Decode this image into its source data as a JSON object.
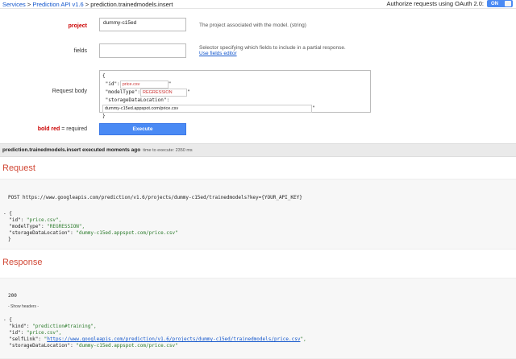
{
  "breadcrumb": {
    "services": "Services",
    "sep1": " > ",
    "api": "Prediction API v1.6",
    "sep2": " > ",
    "method": "prediction.trainedmodels.insert"
  },
  "auth": {
    "label": "Authorize requests using OAuth 2.0:",
    "toggle_state": "ON"
  },
  "form": {
    "project_label": "project",
    "project_value": "dummy-c15ed",
    "project_hint": "The project associated with the model. (string)",
    "fields_label": "fields",
    "fields_value": "",
    "fields_hint": "Selector specifying which fields to include in a partial response.",
    "fields_link": "Use fields editor",
    "body_label": "Request body",
    "body": {
      "open": "{",
      "id_key": "\"id\":",
      "id_val": "price.csv",
      "model_key": "\"modelType\":",
      "model_val": "REGRESSION",
      "storage_key": "\"storageDataLocation\":",
      "storage_val": "dummy-c15ed.appspot.com/price.csv",
      "close": "}"
    },
    "required_note_bold": "bold red",
    "required_note_rest": " = required",
    "execute_label": "Execute"
  },
  "status": {
    "title": "prediction.trainedmodels.insert executed moments ago",
    "time": "time to execute: 2350 ms"
  },
  "request": {
    "title": "Request",
    "line": "POST https://www.googleapis.com/prediction/v1.6/projects/dummy-c15ed/trainedmodels?key={YOUR_API_KEY}",
    "open": "- {",
    "id_key": "  \"id\": ",
    "id_val": "\"price.csv\",",
    "model_key": "  \"modelType\": ",
    "model_val": "\"REGRESSION\",",
    "storage_key": "  \"storageDataLocation\": ",
    "storage_val": "\"dummy-c15ed.appspot.com/price.csv\"",
    "close": "}"
  },
  "response": {
    "title": "Response",
    "code": "200",
    "show_headers": "- Show headers -",
    "open": "- {",
    "kind_key": "  \"kind\": ",
    "kind_val": "\"prediction#training\",",
    "id_key": "  \"id\": ",
    "id_val": "\"price.csv\",",
    "self_key": "  \"selfLink\": ",
    "self_q": "\"",
    "self_val": "https://www.googleapis.com/prediction/v1.6/projects/dummy-c15ed/trainedmodels/price.csv",
    "self_end": "\",",
    "storage_key": "  \"storageDataLocation\": ",
    "storage_val": "\"dummy-c15ed.appspot.com/price.csv\""
  },
  "colors": {
    "accent": "#4a8af4",
    "section_title": "#d14836",
    "string": "#2a7a2a",
    "link": "#1155cc",
    "required": "#cc0000"
  }
}
